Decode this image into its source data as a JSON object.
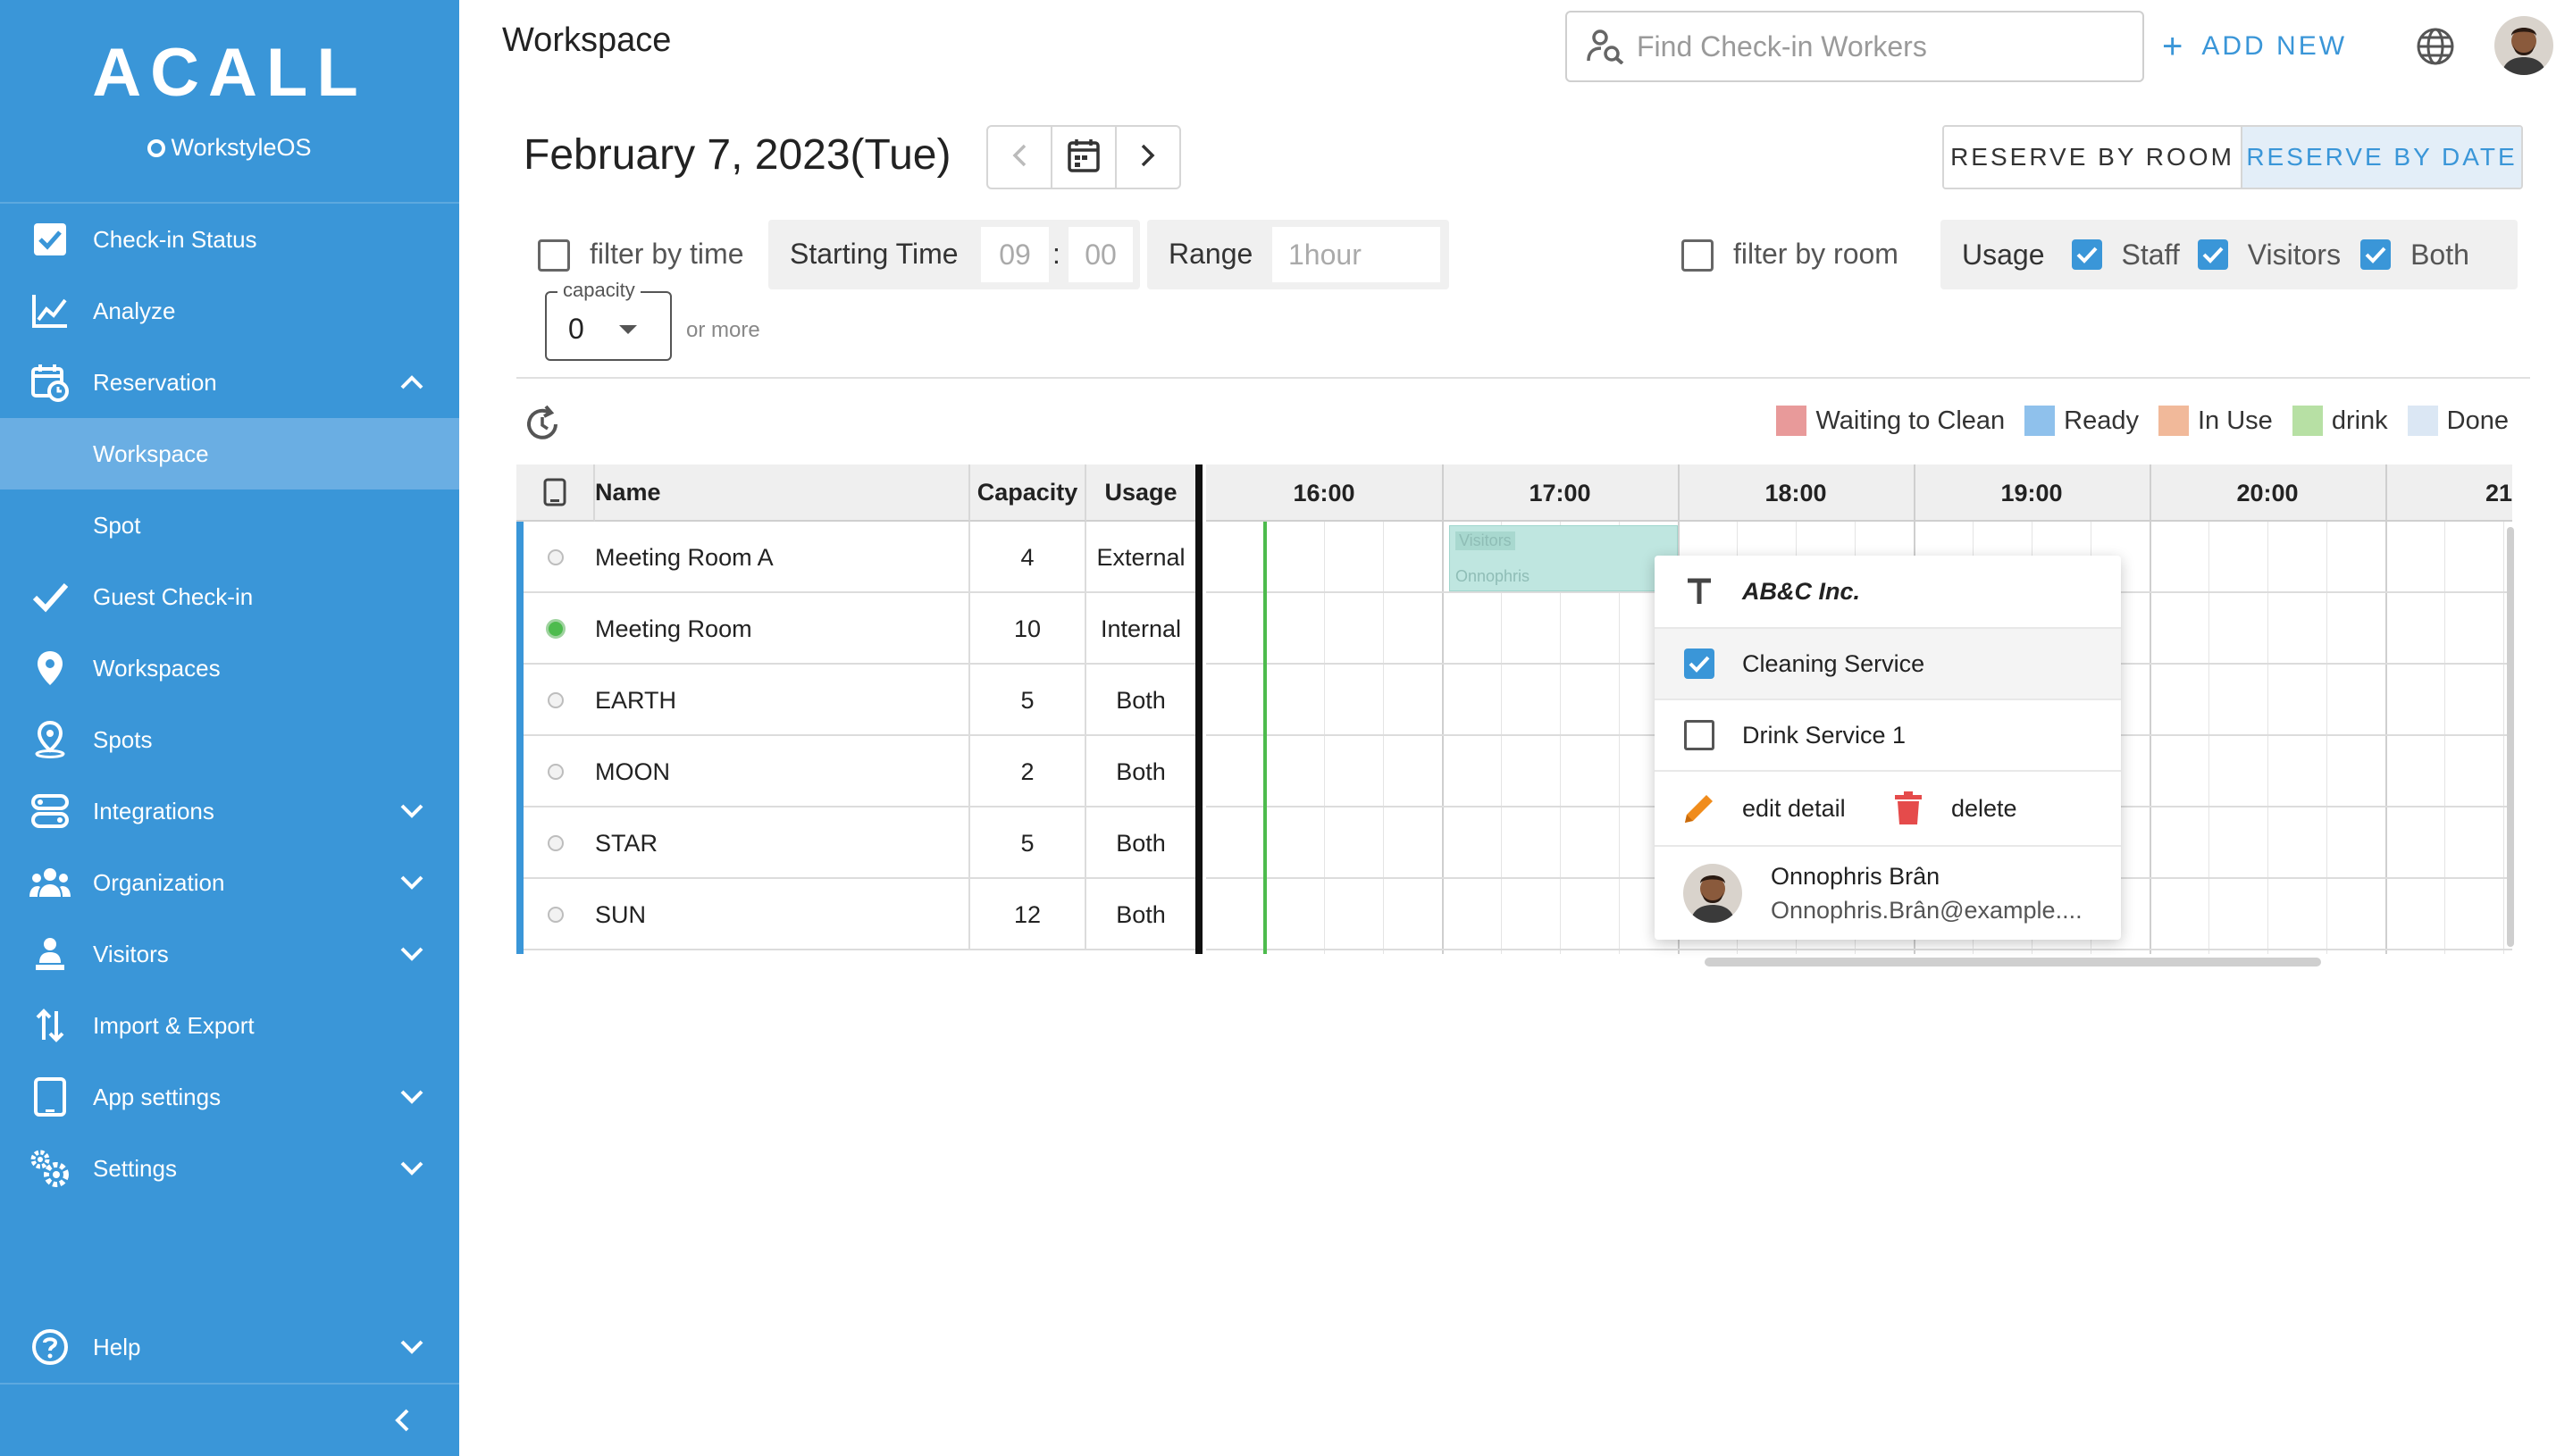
{
  "sidebar": {
    "logo": "ACALL",
    "sublogo": "WorkstyleOS",
    "items": [
      {
        "label": "Check-in Status"
      },
      {
        "label": "Analyze"
      },
      {
        "label": "Reservation"
      },
      {
        "label": "Workspace"
      },
      {
        "label": "Spot"
      },
      {
        "label": "Guest Check-in"
      },
      {
        "label": "Workspaces"
      },
      {
        "label": "Spots"
      },
      {
        "label": "Integrations"
      },
      {
        "label": "Organization"
      },
      {
        "label": "Visitors"
      },
      {
        "label": "Import & Export"
      },
      {
        "label": "App settings"
      },
      {
        "label": "Settings"
      },
      {
        "label": "Help"
      }
    ]
  },
  "header": {
    "title": "Workspace",
    "search_placeholder": "Find Check-in Workers",
    "add_new": "ADD NEW"
  },
  "datebar": {
    "date": "February 7, 2023(Tue)",
    "reserve_by_room": "RESERVE BY ROOM",
    "reserve_by_date": "RESERVE BY DATE"
  },
  "filters": {
    "filter_by_time": "filter by time",
    "starting_time_label": "Starting Time",
    "hour": "09",
    "minute": "00",
    "colon": ":",
    "range_label": "Range",
    "range_value": "1hour",
    "capacity_label": "capacity",
    "capacity_value": "0",
    "or_more": "or more",
    "filter_by_room": "filter by room",
    "usage_label": "Usage",
    "staff": "Staff",
    "visitors": "Visitors",
    "both": "Both"
  },
  "legend": [
    {
      "label": "Waiting to Clean",
      "color": "#e89a9a"
    },
    {
      "label": "Ready",
      "color": "#8fc1ec"
    },
    {
      "label": "In Use",
      "color": "#f1b99a"
    },
    {
      "label": "drink",
      "color": "#b7e0a4"
    },
    {
      "label": "Done",
      "color": "#dbe7f4"
    }
  ],
  "table": {
    "headers": {
      "name": "Name",
      "capacity": "Capacity",
      "usage": "Usage"
    },
    "rows": [
      {
        "name": "Meeting Room A",
        "capacity": "4",
        "usage": "External",
        "active": false
      },
      {
        "name": "Meeting Room",
        "capacity": "10",
        "usage": "Internal",
        "active": true
      },
      {
        "name": "EARTH",
        "capacity": "5",
        "usage": "Both",
        "active": false
      },
      {
        "name": "MOON",
        "capacity": "2",
        "usage": "Both",
        "active": false
      },
      {
        "name": "STAR",
        "capacity": "5",
        "usage": "Both",
        "active": false
      },
      {
        "name": "SUN",
        "capacity": "12",
        "usage": "Both",
        "active": false
      }
    ]
  },
  "timeline": {
    "hours": [
      "16:00",
      "17:00",
      "18:00",
      "19:00",
      "20:00",
      "21"
    ],
    "booking": {
      "line1": "Visitors",
      "line2": "Onnophris"
    }
  },
  "popup": {
    "company": "AB&C Inc.",
    "cleaning": "Cleaning Service",
    "drink": "Drink Service 1",
    "edit": "edit detail",
    "delete": "delete",
    "user_name": "Onnophris Brân",
    "user_email": "Onnophris.Brân@example...."
  },
  "colors": {
    "brand": "#3a96d8",
    "sidebar_active": "#6aaee3",
    "delete": "#e54b4b",
    "edit": "#f08c1c",
    "now_line": "#4dbb4d"
  }
}
